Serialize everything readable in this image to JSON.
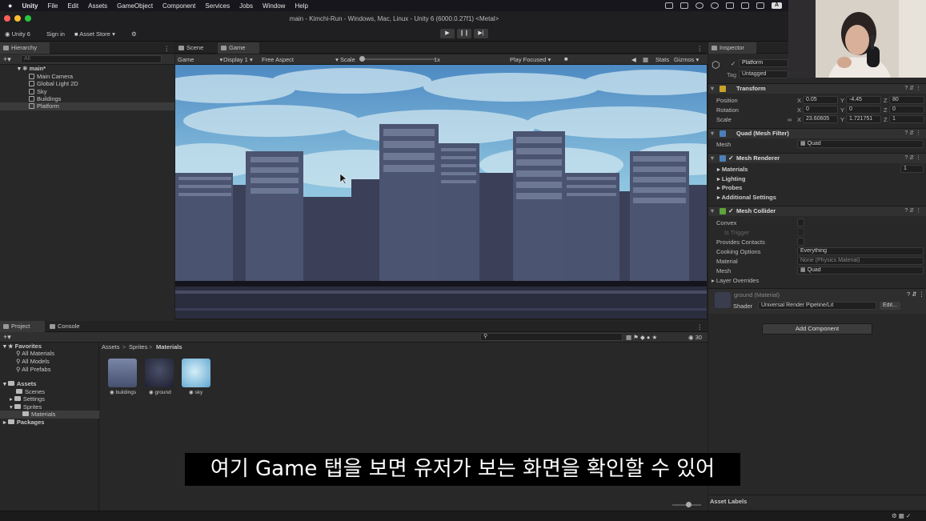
{
  "mac_menu": {
    "items": [
      "Unity",
      "File",
      "Edit",
      "Assets",
      "GameObject",
      "Component",
      "Services",
      "Jobs",
      "Window",
      "Help"
    ],
    "tray_badge": "A"
  },
  "window": {
    "title": "main - Kimchi-Run - Windows, Mac, Linux - Unity 6 (6000.0.27f1) <Metal>",
    "account": "Unity 6",
    "sign_in": "Sign in",
    "asset_store": "Asset Store"
  },
  "hierarchy": {
    "tab": "Hierarchy",
    "search_placeholder": "All",
    "scene": "main*",
    "objects": [
      "Main Camera",
      "Global Light 2D",
      "Sky",
      "Buildings",
      "Platform"
    ]
  },
  "center_tabs": {
    "scene": "Scene",
    "game": "Game"
  },
  "game_bar": {
    "mode": "Game",
    "display": "Display 1",
    "aspect": "Free Aspect",
    "scale_label": "Scale",
    "scale_value": "1x",
    "play_focused": "Play Focused",
    "stats": "Stats",
    "gizmos": "Gizmos"
  },
  "inspector": {
    "tab": "Inspector",
    "object_name": "Platform",
    "tag_label": "Tag",
    "tag_value": "Untagged",
    "transform": {
      "title": "Transform",
      "position_label": "Position",
      "position": {
        "x": "0.05",
        "y": "-4.45",
        "z": "80"
      },
      "rotation_label": "Rotation",
      "rotation": {
        "x": "0",
        "y": "0",
        "z": "0"
      },
      "scale_label": "Scale",
      "scale": {
        "x": "23.60605",
        "y": "1.721751",
        "z": "1"
      }
    },
    "mesh_filter": {
      "title": "Quad (Mesh Filter)",
      "mesh_label": "Mesh",
      "mesh_value": "Quad"
    },
    "mesh_renderer": {
      "title": "Mesh Renderer",
      "materials": "Materials",
      "materials_count": "1",
      "lighting": "Lighting",
      "probes": "Probes",
      "additional": "Additional Settings"
    },
    "mesh_collider": {
      "title": "Mesh Collider",
      "convex": "Convex",
      "is_trigger": "Is Trigger",
      "provides_contacts": "Provides Contacts",
      "cooking_label": "Cooking Options",
      "cooking_value": "Everything",
      "material_label": "Material",
      "material_value": "None (Physics Material)",
      "mesh_label": "Mesh",
      "mesh_value": "Quad",
      "layer_overrides": "Layer Overrides"
    },
    "material": {
      "name": "ground (Material)",
      "shader_label": "Shader",
      "shader_value": "Universal Render Pipeline/Lit",
      "edit": "Edit..."
    },
    "add_component": "Add Component",
    "asset_labels": "Asset Labels"
  },
  "project": {
    "tab": "Project",
    "console_tab": "Console",
    "favorites": "Favorites",
    "fav_items": [
      "All Materials",
      "All Models",
      "All Prefabs"
    ],
    "assets": "Assets",
    "asset_folders": [
      "Scenes",
      "Settings",
      "Sprites"
    ],
    "selected_folder": "Materials",
    "packages": "Packages",
    "breadcrumb": [
      "Assets",
      "Sprites",
      "Materials"
    ],
    "item_count": "30",
    "materials": [
      "buildings",
      "ground",
      "sky"
    ]
  },
  "subtitle": "여기 Game 탭을 보면 유저가 보는 화면을 확인할 수 있어",
  "colors": {
    "sky_top": "#4f8cc4",
    "sky_low": "#a9d1e6",
    "building_dark": "#3b4058",
    "building_mid": "#4b5470",
    "window": "#6c7894",
    "ground": "#2a2d3e"
  }
}
